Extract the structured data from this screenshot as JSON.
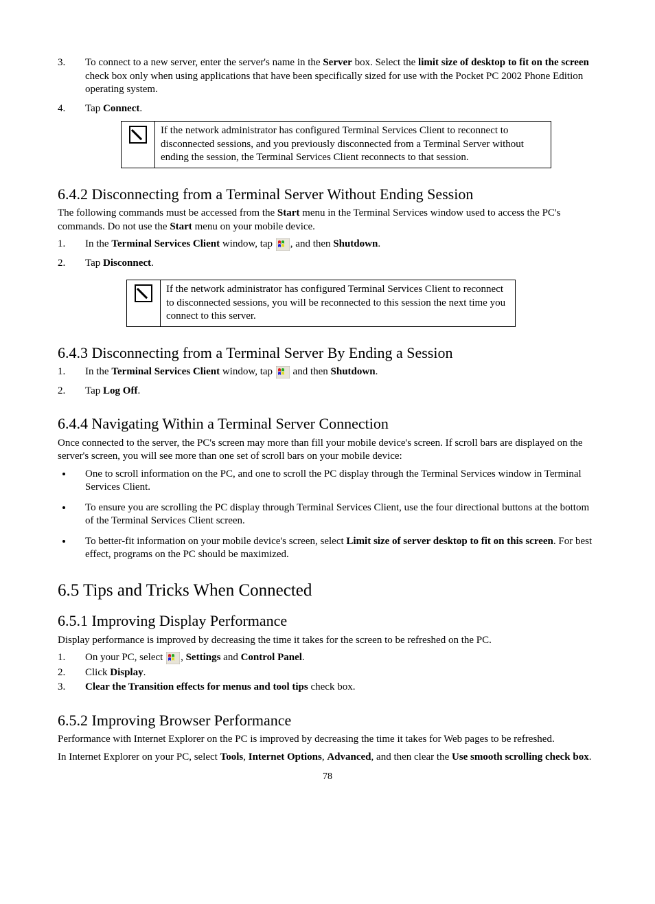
{
  "step3": {
    "num": "3.",
    "t1": "To connect to a new server, enter the server's name in the ",
    "b1": "Server",
    "t2": " box. Select the ",
    "b2": "limit size of desktop to fit on the screen",
    "t3": " check box only when using applications that have been specifically sized for use with the Pocket PC 2002 Phone Edition operating system."
  },
  "step4": {
    "num": "4.",
    "t1": "Tap ",
    "b1": "Connect",
    "t2": "."
  },
  "note1": "If the network administrator has configured Terminal Services Client to reconnect to disconnected sessions, and you previously disconnected from a Terminal Server without ending the session, the Terminal Services Client reconnects to that session.",
  "s642": {
    "title": "6.4.2 Disconnecting from a Terminal Server Without Ending Session",
    "intro_a": "The following commands must be accessed from the ",
    "intro_b1": "Start",
    "intro_b": " menu in the Terminal Services window used to access the PC's commands. Do not use the ",
    "intro_b2": "Start",
    "intro_c": " menu on your mobile device.",
    "step1": {
      "num": "1.",
      "t1": "In the ",
      "b1": "Terminal Services Client",
      "t2": " window, tap ",
      "t3": ", and then ",
      "b2": "Shutdown",
      "t4": "."
    },
    "step2": {
      "num": "2.",
      "t1": "Tap ",
      "b1": "Disconnect",
      "t2": "."
    }
  },
  "note2": "If the network administrator has configured Terminal Services Client to reconnect to disconnected sessions, you will be reconnected to this session the next time you connect to this server.",
  "s643": {
    "title": "6.4.3 Disconnecting from a Terminal Server By Ending a Session",
    "step1": {
      "num": "1.",
      "t1": "In the ",
      "b1": "Terminal Services Client",
      "t2": " window, tap ",
      "t3": " and then ",
      "b2": "Shutdown",
      "t4": "."
    },
    "step2": {
      "num": "2.",
      "t1": "Tap ",
      "b1": "Log Off",
      "t2": "."
    }
  },
  "s644": {
    "title": "6.4.4 Navigating Within a Terminal Server Connection",
    "intro": "Once connected to the server, the PC's screen may more than fill your mobile device's screen. If scroll bars are displayed on the server's screen, you will see more than one set of scroll bars on your mobile device:",
    "bul1": "One to scroll information on the PC, and one to scroll the PC display through the Terminal Services window in Terminal Services Client.",
    "bul2": "To ensure you are scrolling the PC display through Terminal Services Client, use the four directional buttons at the bottom of the Terminal Services Client screen.",
    "bul3a": "To better-fit information on your mobile device's screen, select ",
    "bul3b": "Limit size of server desktop to fit on this screen",
    "bul3c": ". For best effect, programs on the PC should be maximized."
  },
  "s65": {
    "title": "6.5 Tips and Tricks When Connected"
  },
  "s651": {
    "title": "6.5.1 Improving Display Performance",
    "intro": "Display performance is improved by decreasing the time it takes for the screen to be refreshed on the PC.",
    "step1": {
      "num": "1.",
      "t1": "On your PC, select ",
      "t2": ", ",
      "b1": "Settings",
      "t3": " and ",
      "b2": "Control Panel",
      "t4": "."
    },
    "step2": {
      "num": "2.",
      "t1": "Click ",
      "b1": "Display",
      "t2": "."
    },
    "step3": {
      "num": "3.",
      "b1": "Clear the Transition effects for menus and tool tips",
      "t1": " check box."
    }
  },
  "s652": {
    "title": "6.5.2 Improving Browser Performance",
    "p1": "Performance with Internet Explorer on the PC is improved by decreasing the time it takes for Web pages to be refreshed.",
    "p2a": "In Internet Explorer on your PC, select ",
    "b1": "Tools",
    "c1": ", ",
    "b2": "Internet Options",
    "c2": ", ",
    "b3": "Advanced",
    "p2b": ", and then clear the ",
    "b4": "Use smooth scrolling check box",
    "p2c": "."
  },
  "page": "78"
}
